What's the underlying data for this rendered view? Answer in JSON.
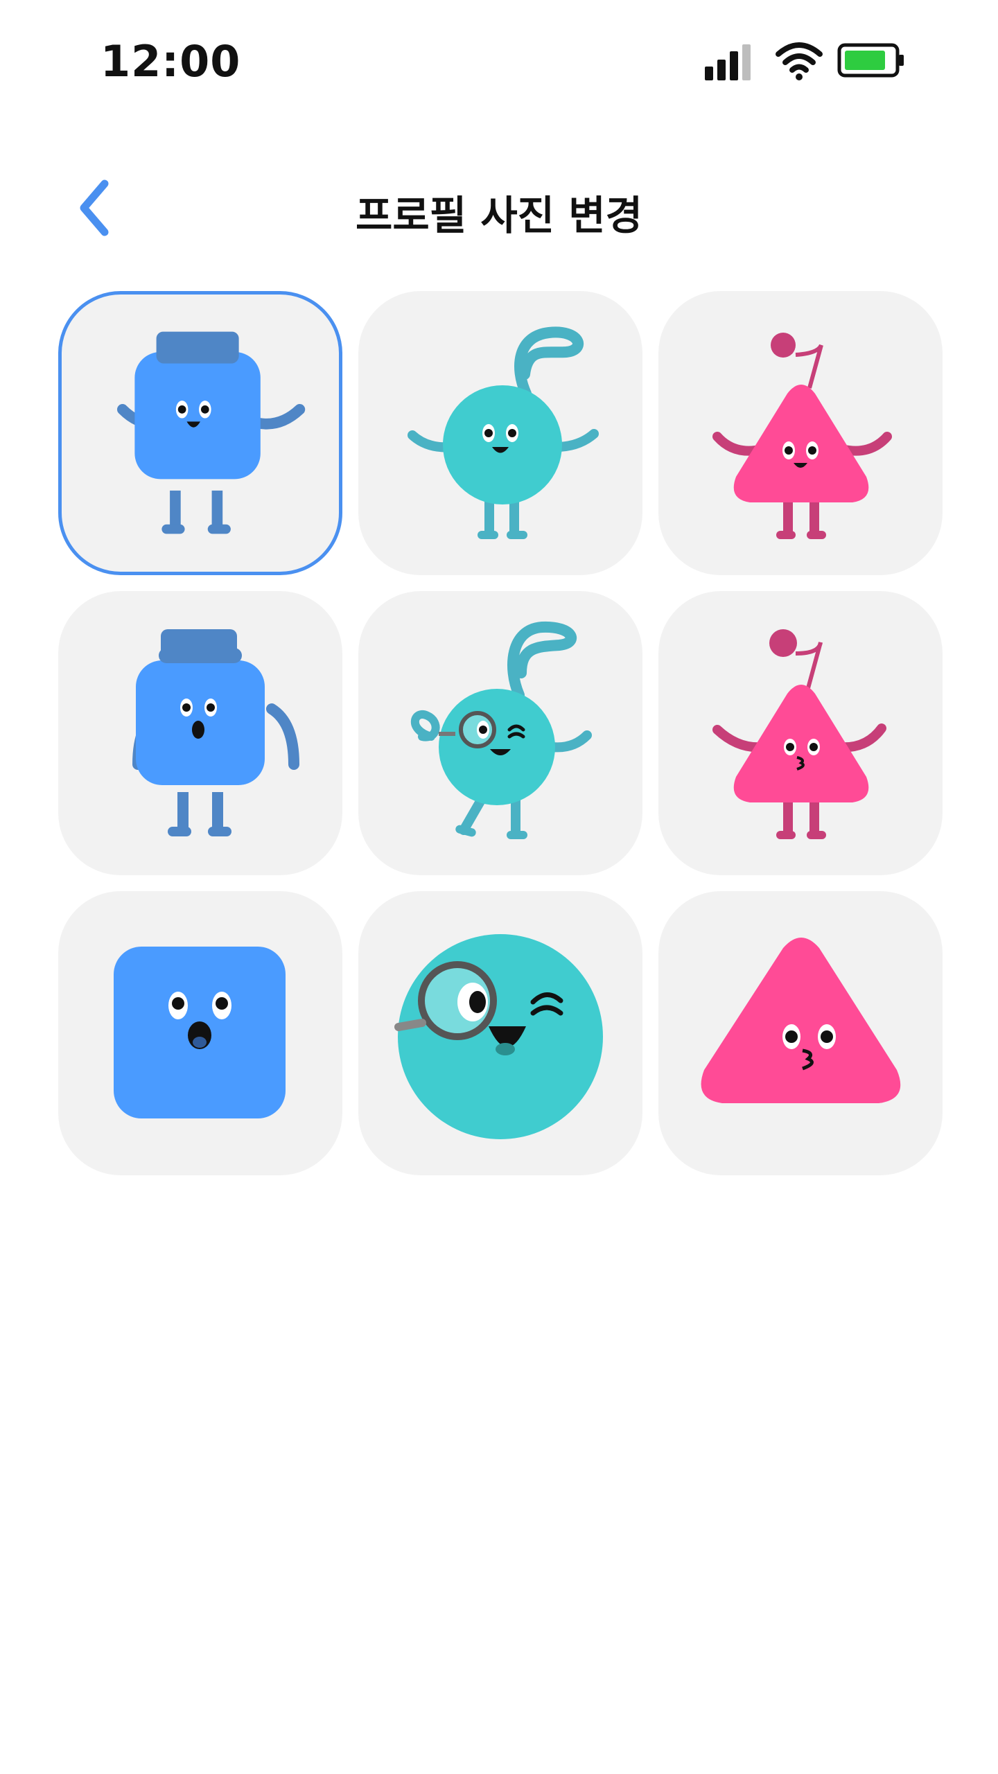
{
  "status_bar": {
    "time": "12:00",
    "icons": [
      "signal-icon",
      "wifi-icon",
      "battery-icon"
    ],
    "battery_color": "#2ecc40"
  },
  "header": {
    "back_icon": "chevron-left-icon",
    "title": "프로필 사진 변경"
  },
  "colors": {
    "accent": "#4a90f0",
    "tile_bg": "#f2f2f2",
    "blue_character": "#4a9bff",
    "teal_character": "#40cccf",
    "pink_character": "#ff4b96"
  },
  "avatars": [
    {
      "name": "blue-square-hat-arms-out",
      "selected": true
    },
    {
      "name": "teal-circle-antenna-arms-out",
      "selected": false
    },
    {
      "name": "pink-triangle-cherry-arms-out",
      "selected": false
    },
    {
      "name": "blue-square-hat-surprised",
      "selected": false
    },
    {
      "name": "teal-circle-monocle-walking",
      "selected": false
    },
    {
      "name": "pink-triangle-cherry-kiss",
      "selected": false
    },
    {
      "name": "blue-square-face",
      "selected": false
    },
    {
      "name": "teal-circle-monocle-face",
      "selected": false
    },
    {
      "name": "pink-triangle-kiss-face",
      "selected": false
    }
  ]
}
